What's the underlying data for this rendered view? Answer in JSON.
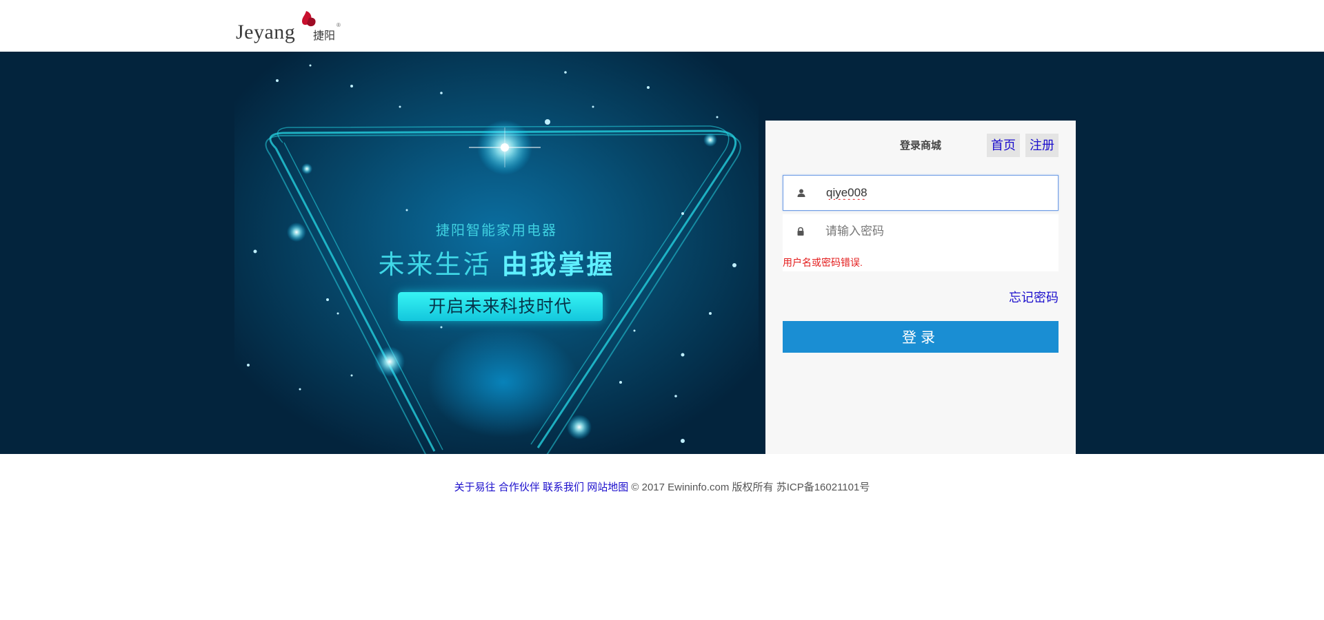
{
  "header": {
    "logo_text": "Jeyang",
    "logo_cn": "捷阳",
    "logo_registered": "®"
  },
  "banner": {
    "subtitle": "捷阳智能家用电器",
    "headline_plain": "未来生活 ",
    "headline_bold": "由我掌握",
    "pill_text": "开启未来科技时代"
  },
  "login": {
    "title": "登录商城",
    "nav_home": "首页",
    "nav_register": "注册",
    "username_value": "qiye008",
    "username_icon": "user-icon",
    "password_placeholder": "请输入密码",
    "password_icon": "lock-icon",
    "error_message": "用户名或密码错误.",
    "forgot_password": "忘记密码",
    "submit_label": "登录"
  },
  "footer": {
    "links": [
      "关于易往",
      "合作伙伴",
      "联系我们",
      "网站地图"
    ],
    "copyright": "© 2017 Ewininfo.com 版权所有 苏ICP备16021101号"
  },
  "colors": {
    "banner_bg": "#03243d",
    "accent": "#1a8ed3",
    "link": "#1a0dcc",
    "error": "#e31b1b",
    "logo_red": "#c8102e"
  }
}
